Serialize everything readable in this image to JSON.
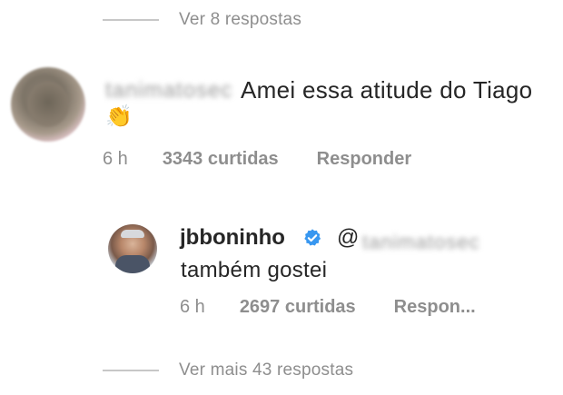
{
  "threads": {
    "top_label": "Ver 8 respostas",
    "bottom_label": "Ver mais 43 respostas"
  },
  "comment": {
    "username": "tanimatosec",
    "text": "Amei essa atitude do Tiago",
    "emoji": "👏",
    "time": "6 h",
    "likes": "3343 curtidas",
    "reply_label": "Responder"
  },
  "reply": {
    "username": "jbboninho",
    "mention_at": "@",
    "mention": "tanimatosec",
    "text": "também gostei",
    "time": "6 h",
    "likes": "2697 curtidas",
    "reply_label": "Respon..."
  },
  "icons": {
    "verified": "verified-badge-icon",
    "verified_color": "#3897f0"
  }
}
